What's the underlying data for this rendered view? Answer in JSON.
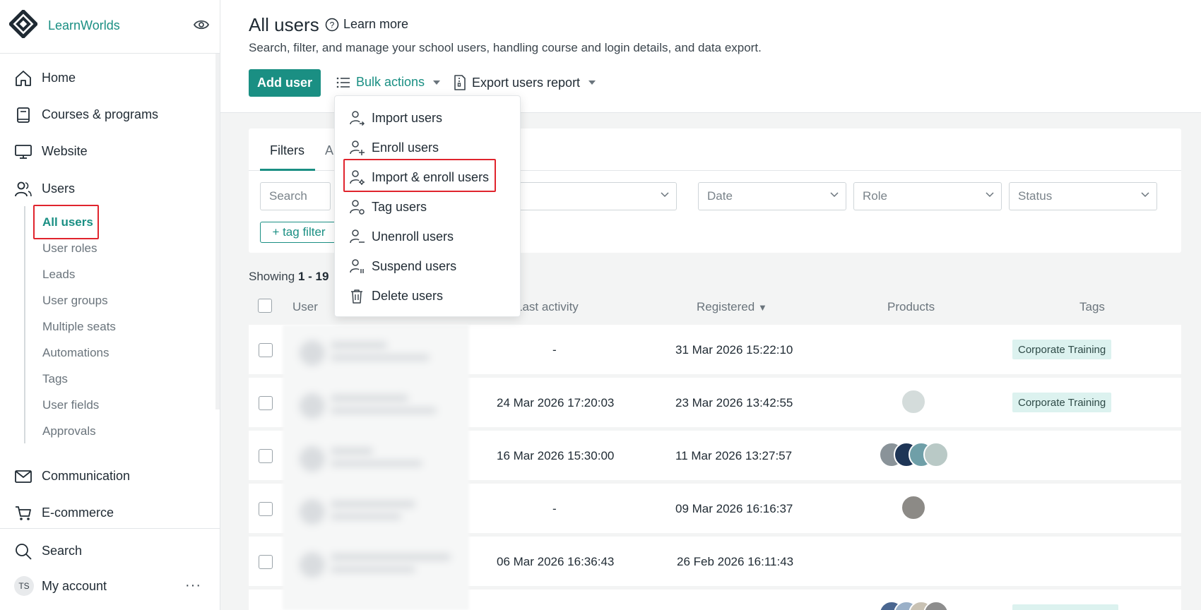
{
  "sidebar": {
    "brand": "LearnWorlds",
    "nav": {
      "home": "Home",
      "courses": "Courses & programs",
      "website": "Website",
      "users": "Users",
      "communication": "Communication",
      "ecommerce": "E-commerce",
      "search": "Search",
      "account": "My account"
    },
    "users_sub": [
      "All users",
      "User roles",
      "Leads",
      "User groups",
      "Multiple seats",
      "Automations",
      "Tags",
      "User fields",
      "Approvals"
    ],
    "avatar_initials": "TS",
    "more": "···"
  },
  "header": {
    "title": "All users",
    "learn_more": "Learn more",
    "subtitle": "Search, filter, and manage your school users, handling course and login details, and data export.",
    "add_user": "Add user",
    "bulk_actions": "Bulk actions",
    "export_report": "Export users report"
  },
  "bulk_menu": [
    "Import users",
    "Enroll users",
    "Import & enroll users",
    "Tag users",
    "Unenroll users",
    "Suspend users",
    "Delete users"
  ],
  "filters": {
    "tab_active": "Filters",
    "tab_other": "A",
    "search_placeholder": "Search",
    "date": "Date",
    "role": "Role",
    "status": "Status",
    "tag_filter": "+ tag filter"
  },
  "table": {
    "showing_prefix": "Showing ",
    "showing_range": "1 - 19",
    "columns": {
      "user": "User",
      "last_activity": "Last activity",
      "registered": "Registered",
      "products": "Products",
      "tags": "Tags"
    },
    "sort_marker": "▼",
    "rows": [
      {
        "last_activity": "-",
        "registered": "31 Mar 2026 15:22:10",
        "tag": "Corporate Training"
      },
      {
        "last_activity": "24 Mar 2026 17:20:03",
        "registered": "23 Mar 2026 13:42:55",
        "tag": "Corporate Training"
      },
      {
        "last_activity": "16 Mar 2026 15:30:00",
        "registered": "11 Mar 2026 13:27:57",
        "tag": ""
      },
      {
        "last_activity": "-",
        "registered": "09 Mar 2026 16:16:37",
        "tag": ""
      },
      {
        "last_activity": "06 Mar 2026 16:36:43",
        "registered": "26 Feb 2026 16:11:43",
        "tag": ""
      }
    ]
  },
  "colors": {
    "accent": "#1a8f83",
    "highlight": "#e0242d",
    "tag_bg": "#dcf2ef"
  }
}
